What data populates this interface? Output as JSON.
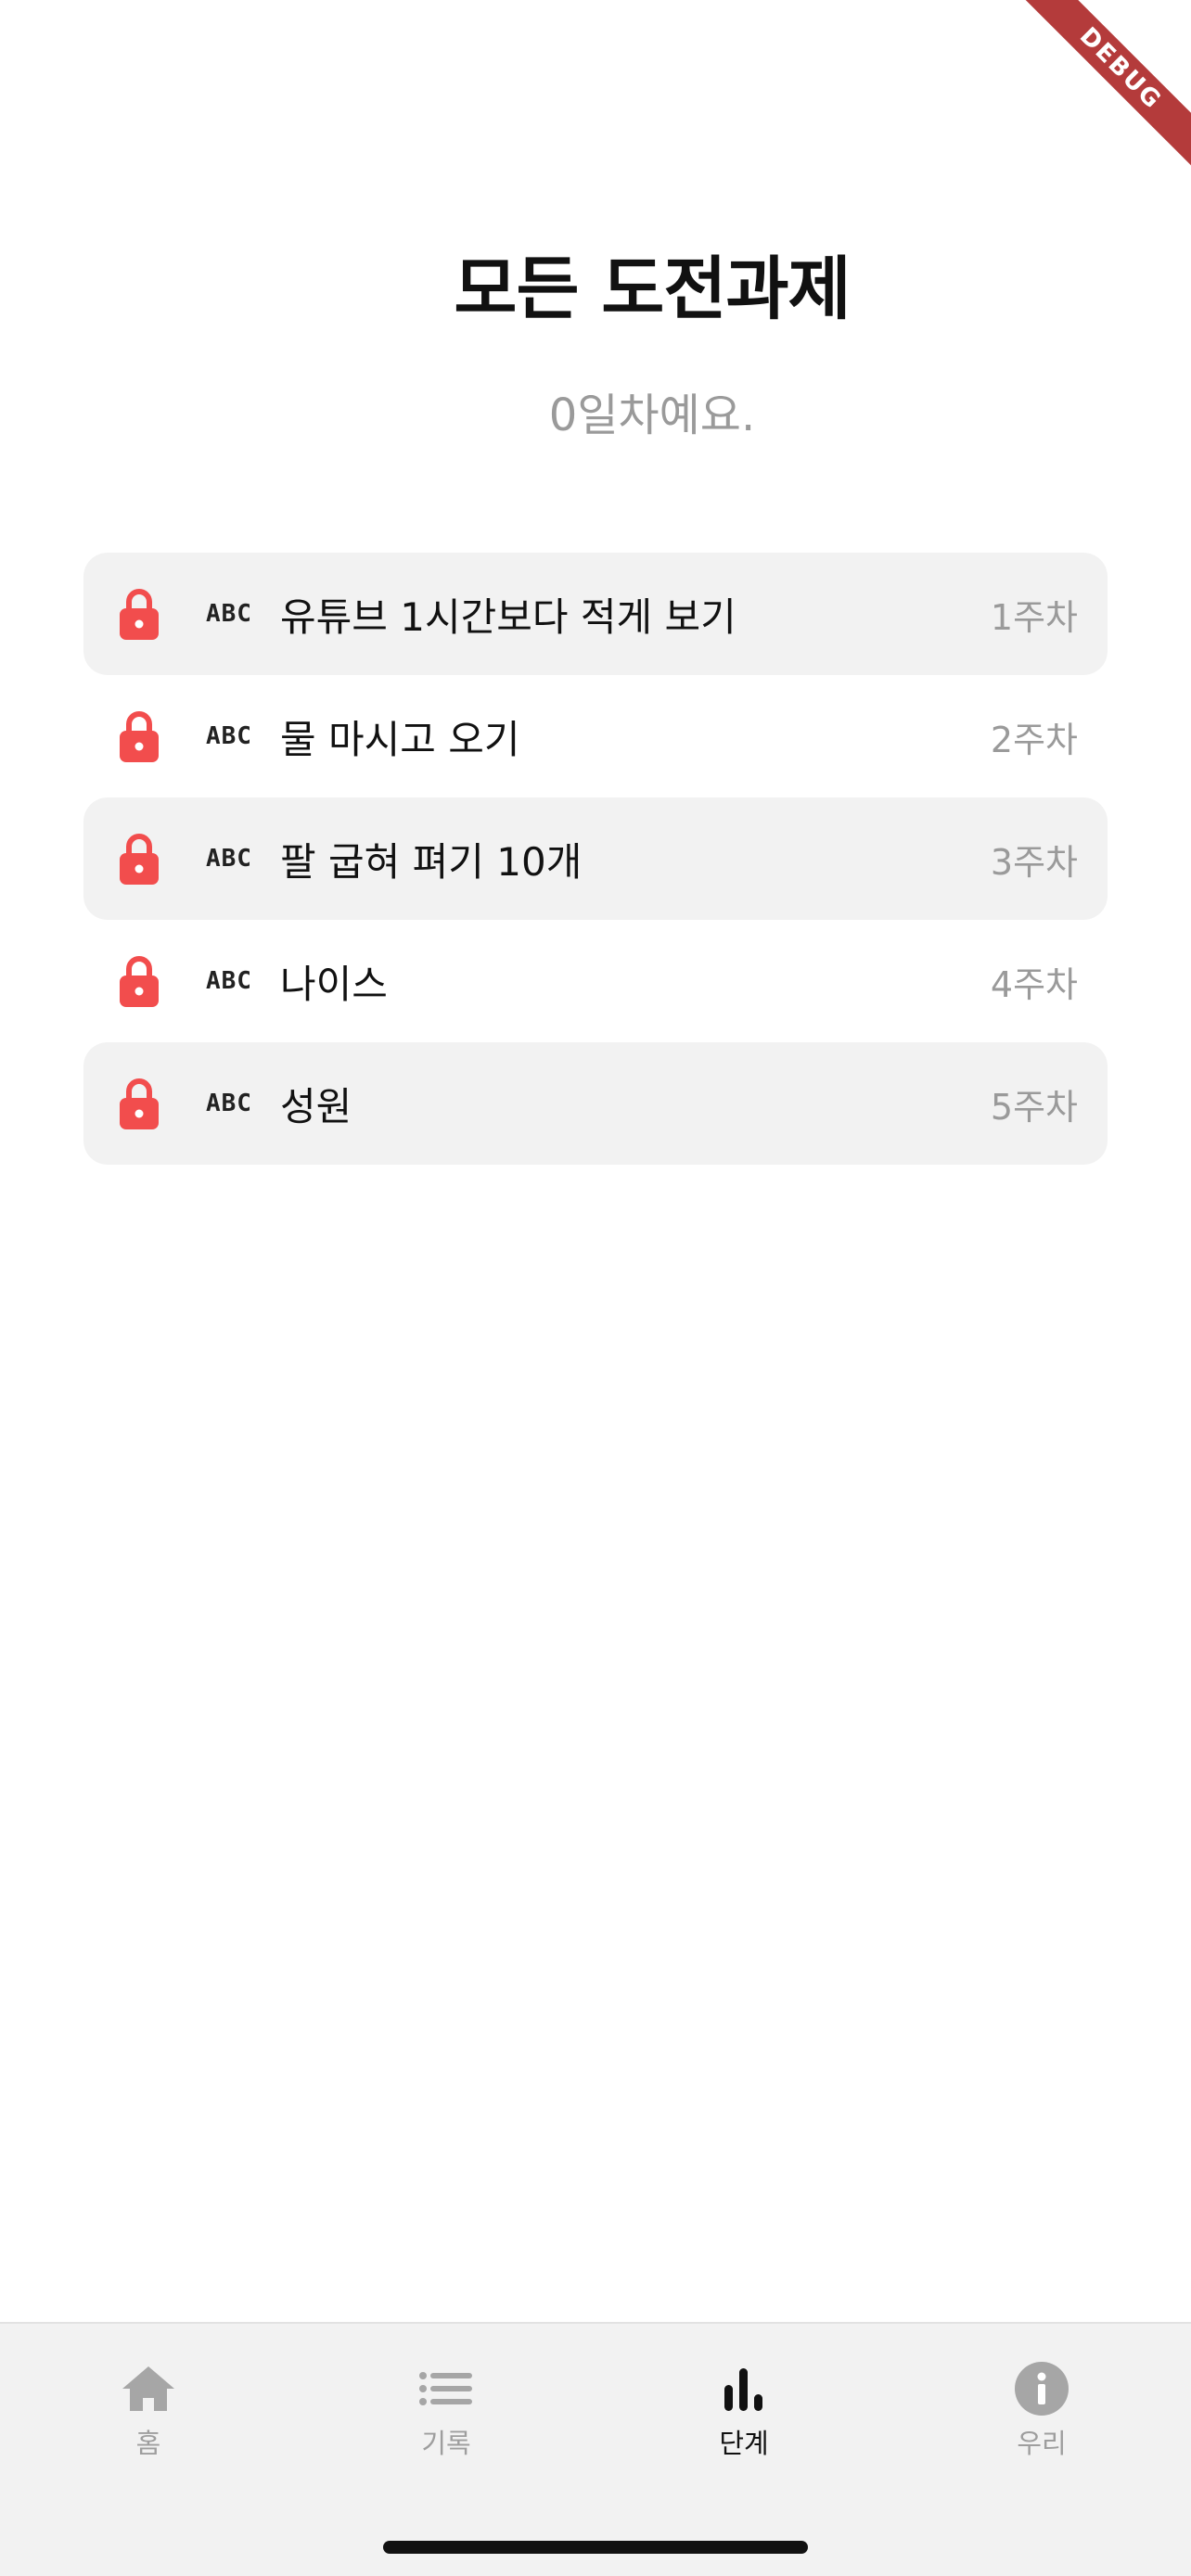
{
  "debug_banner": "DEBUG",
  "header": {
    "title": "모든 도전과제",
    "subtitle": "0일차예요."
  },
  "challenges": [
    {
      "type_icon": "ABC",
      "title": "유튜브 1시간보다 적게 보기",
      "week": "1주차",
      "locked": true,
      "icon": "lock-icon"
    },
    {
      "type_icon": "ABC",
      "title": "물 마시고 오기",
      "week": "2주차",
      "locked": true,
      "icon": "lock-icon"
    },
    {
      "type_icon": "ABC",
      "title": "팔 굽혀 펴기 10개",
      "week": "3주차",
      "locked": true,
      "icon": "lock-icon"
    },
    {
      "type_icon": "ABC",
      "title": "나이스",
      "week": "4주차",
      "locked": true,
      "icon": "lock-icon"
    },
    {
      "type_icon": "ABC",
      "title": "성원",
      "week": "5주차",
      "locked": true,
      "icon": "lock-icon"
    }
  ],
  "bottom_nav": {
    "items": [
      {
        "label": "홈",
        "icon": "home-icon",
        "active": false
      },
      {
        "label": "기록",
        "icon": "list-icon",
        "active": false
      },
      {
        "label": "단계",
        "icon": "bar-chart-icon",
        "active": true
      },
      {
        "label": "우리",
        "icon": "info-icon",
        "active": false
      }
    ]
  },
  "colors": {
    "lock": "#f24d4d",
    "row_shade": "#f2f2f2",
    "muted_text": "#9a9a9a",
    "nav_background": "#f2f2f2",
    "nav_inactive": "#a6a6a6",
    "nav_active": "#111111",
    "debug_banner": "#b43b3b"
  }
}
